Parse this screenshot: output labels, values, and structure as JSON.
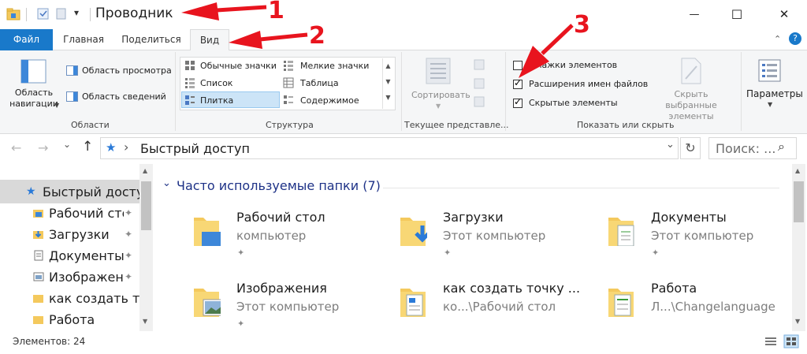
{
  "titlebar": {
    "title": "Проводник",
    "customize_glyph": "▾",
    "minimize_glyph": "—",
    "maximize_glyph": "☐",
    "close_glyph": "✕"
  },
  "annotations": {
    "label_1": "1",
    "label_2": "2",
    "label_3": "3",
    "arrow_color": "#e8141e"
  },
  "tabs": {
    "file": "Файл",
    "home": "Главная",
    "share": "Поделиться",
    "view": "Вид",
    "help_glyph": "?"
  },
  "ribbon": {
    "areas": {
      "nav_pane_line1": "Область",
      "nav_pane_line2": "навигации",
      "preview_pane": "Область просмотра",
      "details_pane": "Область сведений",
      "title": "Области"
    },
    "layout": {
      "normal_icons": "Обычные значки",
      "small_icons": "Мелкие значки",
      "list": "Список",
      "table": "Таблица",
      "tile": "Плитка",
      "content": "Содержимое",
      "title": "Структура"
    },
    "current_view": {
      "sort": "Сортировать",
      "title": "Текущее представле..."
    },
    "show_hide": {
      "item_checkboxes": "Флажки элементов",
      "file_extensions": "Расширения имен файлов",
      "hidden_items": "Скрытые элементы",
      "item_checkboxes_checked": false,
      "file_extensions_checked": true,
      "hidden_items_checked": true,
      "hide_selected_line1": "Скрыть выбранные",
      "hide_selected_line2": "элементы",
      "title": "Показать или скрыть"
    },
    "options": {
      "label": "Параметры"
    }
  },
  "addressbar": {
    "back_glyph": "←",
    "forward_glyph": "→",
    "recent_glyph": "⌄",
    "up_glyph": "↑",
    "separator_glyph": "›",
    "path": "Быстрый доступ",
    "dropdown_glyph": "⌄",
    "refresh_glyph": "↻",
    "search_placeholder": "Поиск: ...",
    "search_glyph": "⌕"
  },
  "sidebar": {
    "items": [
      {
        "label": "Быстрый доступ",
        "pinned": false,
        "icon": "star-icon"
      },
      {
        "label": "Рабочий стол",
        "pinned": true,
        "icon": "desktop-folder-icon"
      },
      {
        "label": "Загрузки",
        "pinned": true,
        "icon": "downloads-folder-icon"
      },
      {
        "label": "Документы",
        "pinned": true,
        "icon": "documents-folder-icon"
      },
      {
        "label": "Изображения",
        "pinned": true,
        "icon": "pictures-folder-icon"
      },
      {
        "label": "как создать точку",
        "pinned": false,
        "icon": "folder-icon"
      },
      {
        "label": "Работа",
        "pinned": false,
        "icon": "folder-icon"
      }
    ],
    "pin_glyph": "✦"
  },
  "content": {
    "section_title": "Часто используемые папки (7)",
    "tiles": [
      {
        "name": "Рабочий стол",
        "sub": "компьютер",
        "pinned": true,
        "icon": "desktop-folder-icon"
      },
      {
        "name": "Загрузки",
        "sub": "Этот компьютер",
        "pinned": true,
        "icon": "downloads-folder-icon"
      },
      {
        "name": "Документы",
        "sub": "Этот компьютер",
        "pinned": true,
        "icon": "documents-folder-icon"
      },
      {
        "name": "Изображения",
        "sub": "Этот компьютер",
        "pinned": true,
        "icon": "pictures-folder-icon"
      },
      {
        "name": "как создать точку ...",
        "sub": "ко...\\Рабочий стол",
        "pinned": false,
        "icon": "folder-icon"
      },
      {
        "name": "Работа",
        "sub": "Л...\\Changelanguage",
        "pinned": false,
        "icon": "folder-icon"
      }
    ]
  },
  "statusbar": {
    "item_count": "Элементов: 24"
  }
}
